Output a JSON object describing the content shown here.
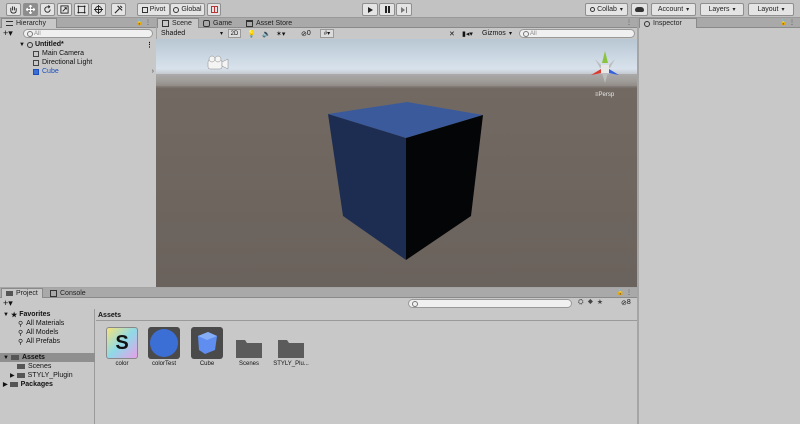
{
  "toolbar": {
    "pivot_label": "Pivot",
    "global_label": "Global",
    "collab_label": "Collab",
    "account_label": "Account",
    "layers_label": "Layers",
    "layout_label": "Layout",
    "tools": [
      "hand-tool-icon",
      "move-tool-icon",
      "rotate-tool-icon",
      "scale-tool-icon",
      "rect-tool-icon",
      "transform-tool-icon",
      "custom-tool-icon"
    ]
  },
  "hierarchy": {
    "tab_label": "Hierarchy",
    "search_placeholder": "All",
    "scene_name": "Untitled*",
    "items": [
      {
        "label": "Main Camera",
        "color": "#111111"
      },
      {
        "label": "Directional Light",
        "color": "#111111"
      },
      {
        "label": "Cube",
        "color": "#1a4fbf"
      }
    ]
  },
  "scene_tabs": [
    {
      "label": "Scene",
      "active": true
    },
    {
      "label": "Game",
      "active": false
    },
    {
      "label": "Asset Store",
      "active": false
    }
  ],
  "scene_toolbar": {
    "shading_mode": "Shaded",
    "mode_2d": "2D",
    "hidden_count": "0",
    "gizmos_label": "Gizmos",
    "search_placeholder": "All",
    "persp_label": "Persp"
  },
  "inspector": {
    "tab_label": "Inspector"
  },
  "bottom_tabs": [
    {
      "label": "Project",
      "active": true
    },
    {
      "label": "Console",
      "active": false
    }
  ],
  "project": {
    "badge_count": "8",
    "favorites_label": "Favorites",
    "favorites": [
      "All Materials",
      "All Models",
      "All Prefabs"
    ],
    "assets_label": "Assets",
    "asset_folders": [
      "Scenes",
      "STYLY_Plugin"
    ],
    "packages_label": "Packages",
    "breadcrumb": "Assets",
    "asset_items": [
      {
        "label": "color",
        "kind": "shader"
      },
      {
        "label": "colorTest",
        "kind": "material"
      },
      {
        "label": "Cube",
        "kind": "prefab"
      },
      {
        "label": "Scenes",
        "kind": "folder"
      },
      {
        "label": "STYLY_Plu...",
        "kind": "folder"
      }
    ]
  },
  "colors": {
    "cube_front": "#1d2d52",
    "cube_top": "#3b5a9c",
    "cube_side": "#040506",
    "ground": "#6a625c",
    "selection_blue": "#1a4fbf"
  }
}
